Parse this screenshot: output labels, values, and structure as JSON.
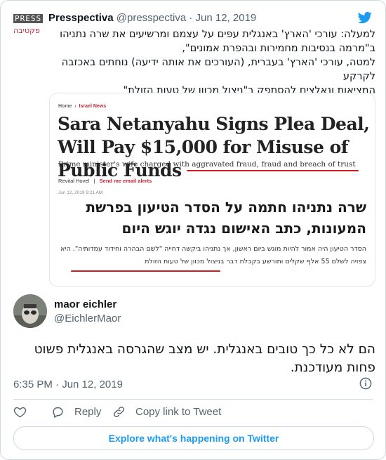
{
  "quoted_tweet": {
    "avatar_logo_text": "PRESS",
    "avatar_logo_subtext": "פקטיבה",
    "author_name": "Presspectiva",
    "handle_date": "@presspectiva · Jun 12, 2019",
    "text_lines": [
      "למעלה: עורכי 'הארץ' באנגלית עפים על עצמם ומרשיעים את שרה נתניהו",
      "ב\"מרמה בנסיבות מחמירות ובהפרת אמונים\",",
      "למטה, עורכי 'הארץ' בעברית, (העורכים את אותה ידיעה) נוחתים באכזבה לקרקע",
      "המציאות ונאלצים להסתפק ב\"ניצול מכוון של טעות הזולת\""
    ],
    "article": {
      "breadcrumb_home": "Home",
      "breadcrumb_section": "Israel News",
      "headline": "Sara Netanyahu Signs Plea Deal, Will Pay $15,000 for Misuse of Public Funds",
      "subhead": "Prime minister's wife charged with aggravated fraud, fraud and breach of trust",
      "author": "Revital Hovel",
      "alert": "Send me email alerts",
      "date": "Jun 12, 2019 9:21 AM",
      "hebrew_headline": "שרה נתניהו חתמה על הסדר הטיעון בפרשת המעונות, כתב האישום נגדה יוגש היום",
      "hebrew_body": "הסדר הטיעון היה אמור להיות מוגש ביום ראשון, אך נתניהו ביקשה דחייה \"לשם הבהרה וחידוד עמדותיה\". היא צפויה לשלם 55 אלף שקלים ותורשע בקבלת דבר בניצול מכוון של טעות הזולת"
    }
  },
  "reply": {
    "author_name": "maor eichler",
    "handle": "@EichlerMaor",
    "text": "הם לא כל כך טובים באנגלית. יש מצב שהגרסה באנגלית פשוט פחות מעודכנת.",
    "timestamp": "6:35 PM · Jun 12, 2019"
  },
  "actions": {
    "reply_label": "Reply",
    "copy_link_label": "Copy link to Tweet"
  },
  "explore_label": "Explore what's happening on Twitter",
  "icons": {
    "brand": "twitter-bird-icon",
    "like": "heart-icon",
    "reply": "reply-bubble-icon",
    "copy": "link-icon",
    "info": "info-icon"
  },
  "colors": {
    "twitter_blue": "#1d9bf0",
    "text_secondary": "#536471",
    "underline_red": "#d21b1b"
  }
}
